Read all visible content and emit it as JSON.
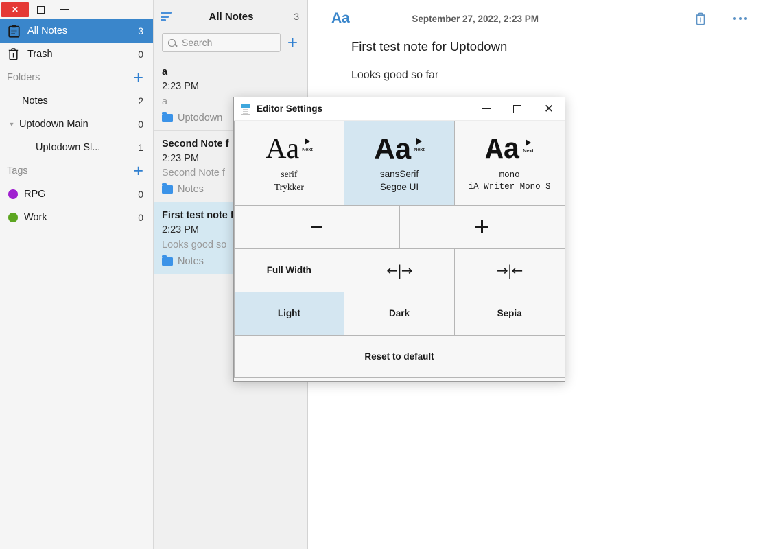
{
  "window_controls": {
    "close_label": "✕",
    "maximize_icon": "square-icon",
    "minimize_icon": "dash-icon"
  },
  "sidebar": {
    "primary": [
      {
        "label": "All Notes",
        "count": "3",
        "icon": "notepad-icon",
        "selected": true
      },
      {
        "label": "Trash",
        "count": "0",
        "icon": "trash-icon",
        "selected": false
      }
    ],
    "folders_section": {
      "label": "Folders",
      "add_label": "+"
    },
    "folders": [
      {
        "label": "Notes",
        "count": "2",
        "indent": 1,
        "twisty": ""
      },
      {
        "label": "Uptodown Main",
        "count": "0",
        "indent": 0,
        "twisty": "▼"
      },
      {
        "label": "Uptodown Sl...",
        "count": "1",
        "indent": 2,
        "twisty": ""
      }
    ],
    "tags_section": {
      "label": "Tags",
      "add_label": "+"
    },
    "tags": [
      {
        "label": "RPG",
        "count": "0",
        "color": "#a020d0"
      },
      {
        "label": "Work",
        "count": "0",
        "color": "#5ca520"
      }
    ]
  },
  "notelist": {
    "sort_icon": "sort-icon",
    "title": "All Notes",
    "count": "3",
    "search": {
      "placeholder": "Search",
      "value": ""
    },
    "add_label": "+",
    "items": [
      {
        "title": "a",
        "time": "2:23 PM",
        "excerpt": "a",
        "folder": "Uptodown",
        "selected": false
      },
      {
        "title": "Second Note f",
        "time": "2:23 PM",
        "excerpt": "Second Note f",
        "folder": "Notes",
        "selected": false
      },
      {
        "title": "First test note f",
        "time": "2:23 PM",
        "excerpt": "Looks good so",
        "folder": "Notes",
        "selected": true
      }
    ]
  },
  "editor": {
    "font_button_label": "Aa",
    "date": "September 27, 2022, 2:23 PM",
    "trash_icon": "trash-icon",
    "more_icon": "ellipsis-icon",
    "note_title": "First test note for Uptodown",
    "note_body": "Looks good so far"
  },
  "modal": {
    "title": "Editor Settings",
    "app_icon": "document-icon",
    "minimize_label": "minimize-icon",
    "maximize_label": "maximize-icon",
    "close_label": "✕",
    "fonts": [
      {
        "sample": "Aa",
        "next_label": "Next",
        "key": "serif",
        "name": "Trykker",
        "selected": false
      },
      {
        "sample": "Aa",
        "next_label": "Next",
        "key": "sansSerif",
        "name": "Segoe UI",
        "selected": true
      },
      {
        "sample": "Aa",
        "next_label": "Next",
        "key": "mono",
        "name": "iA Writer Mono S",
        "selected": false
      }
    ],
    "size": {
      "decrease_label": "−",
      "increase_label": "+"
    },
    "width": [
      {
        "label": "Full Width",
        "selected": false
      },
      {
        "label": "←|→",
        "selected": false
      },
      {
        "label": "→|←",
        "selected": false
      }
    ],
    "themes": [
      {
        "label": "Light",
        "selected": true
      },
      {
        "label": "Dark",
        "selected": false
      },
      {
        "label": "Sepia",
        "selected": false
      }
    ],
    "reset_label": "Reset to default"
  },
  "colors": {
    "accent_blue": "#3a86cb",
    "selection_blue": "#d4e8f2",
    "modal_selected": "#d4e6f1",
    "close_red": "#e53935",
    "plus_blue": "#2f7fd0",
    "folder_blue": "#3b93e8"
  }
}
